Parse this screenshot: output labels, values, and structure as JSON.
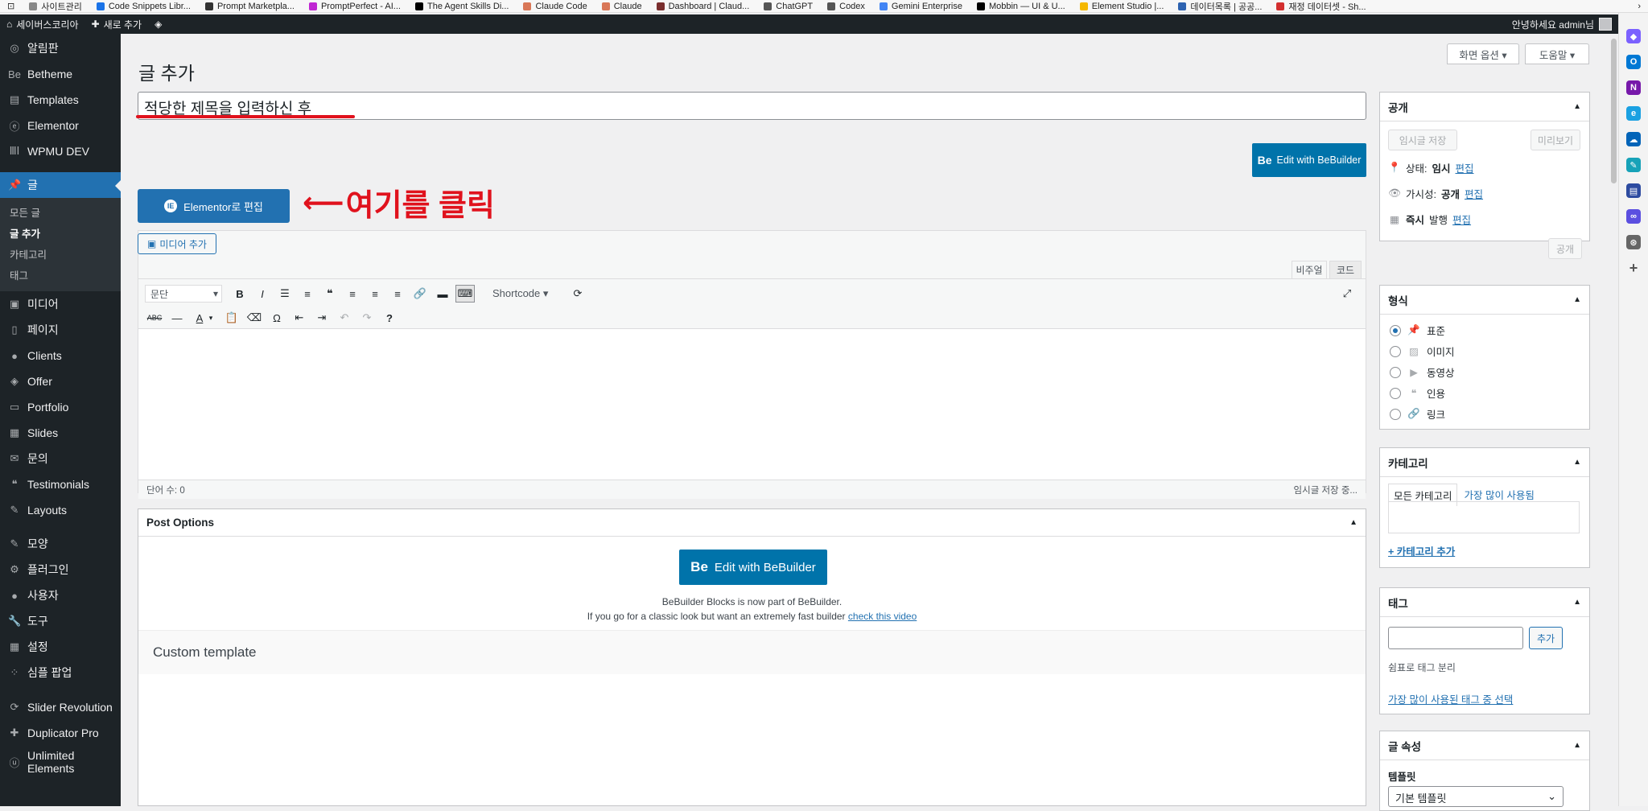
{
  "bookmarks": [
    {
      "label": "사이트관리",
      "color": "#888"
    },
    {
      "label": "Code Snippets Libr...",
      "color": "#1a73e8"
    },
    {
      "label": "Prompt Marketpla...",
      "color": "#333"
    },
    {
      "label": "PromptPerfect - AI...",
      "color": "#c026d3"
    },
    {
      "label": "The Agent Skills Di...",
      "color": "#000"
    },
    {
      "label": "Claude Code",
      "color": "#d97757"
    },
    {
      "label": "Claude",
      "color": "#d97757"
    },
    {
      "label": "Dashboard | Claud...",
      "color": "#7a2e2e"
    },
    {
      "label": "ChatGPT",
      "color": "#555"
    },
    {
      "label": "Codex",
      "color": "#555"
    },
    {
      "label": "Gemini Enterprise",
      "color": "#4285f4"
    },
    {
      "label": "Mobbin — UI & U...",
      "color": "#000"
    },
    {
      "label": "Element Studio |...",
      "color": "#f5b800"
    },
    {
      "label": "데이터목록 | 공공...",
      "color": "#2d62b0"
    },
    {
      "label": "재정 데이터셋 - Sh...",
      "color": "#d32f2f"
    }
  ],
  "adminbar": {
    "site": "세이버스코리아",
    "new": "새로 추가",
    "greeting": "안녕하세요 admin님"
  },
  "menu": {
    "items_top": [
      {
        "label": "알림판",
        "icon": "◎"
      },
      {
        "label": "Betheme",
        "icon": "Be"
      },
      {
        "label": "Templates",
        "icon": "▤"
      },
      {
        "label": "Elementor",
        "icon": "ⓔ"
      },
      {
        "label": "WPMU DEV",
        "icon": "ⅢⅠ"
      }
    ],
    "current": {
      "label": "글",
      "icon": "📌"
    },
    "sub": [
      "모든 글",
      "글 추가",
      "카테고리",
      "태그"
    ],
    "items_mid": [
      {
        "label": "미디어",
        "icon": "▣"
      },
      {
        "label": "페이지",
        "icon": "▯"
      },
      {
        "label": "Clients",
        "icon": "●"
      },
      {
        "label": "Offer",
        "icon": "◈"
      },
      {
        "label": "Portfolio",
        "icon": "▭"
      },
      {
        "label": "Slides",
        "icon": "▦"
      },
      {
        "label": "문의",
        "icon": "✉"
      },
      {
        "label": "Testimonials",
        "icon": "❝"
      },
      {
        "label": "Layouts",
        "icon": "✎"
      }
    ],
    "items_bottom": [
      {
        "label": "모양",
        "icon": "✎"
      },
      {
        "label": "플러그인",
        "icon": "⚙"
      },
      {
        "label": "사용자",
        "icon": "●"
      },
      {
        "label": "도구",
        "icon": "🔧"
      },
      {
        "label": "설정",
        "icon": "▦"
      },
      {
        "label": "심플 팝업",
        "icon": "⁘"
      }
    ],
    "items_plugins": [
      {
        "label": "Slider Revolution",
        "icon": "⟳"
      },
      {
        "label": "Duplicator Pro",
        "icon": "✚"
      },
      {
        "label": "Unlimited Elements",
        "icon": "ⓤ"
      }
    ]
  },
  "page": {
    "title": "글 추가",
    "screen_options": "화면 옵션 ▾",
    "help": "도움말 ▾",
    "post_title": "적당한 제목을 입력하신 후",
    "bebuilder_button": "Edit with BeBuilder",
    "elementor_button": "Elementor로 편집",
    "annotation": "여기를 클릭",
    "add_media": "미디어 추가",
    "tab_visual": "비주얼",
    "tab_code": "코드",
    "format": "문단",
    "shortcode": "Shortcode ▾",
    "word_count": "단어 수: 0",
    "draft_status": "임시글 저장 중..."
  },
  "post_options": {
    "title": "Post Options",
    "button": "Edit with BeBuilder",
    "note1": "BeBuilder Blocks is now part of BeBuilder.",
    "note2": "If you go for a classic look but want an extremely fast builder",
    "note_link": "check this video",
    "custom_template": "Custom template"
  },
  "publish": {
    "title": "공개",
    "save_draft": "임시글 저장",
    "preview": "미리보기",
    "status_label": "상태:",
    "status_value": "임시",
    "visibility_label": "가시성:",
    "visibility_value": "공개",
    "schedule_value": "즉시",
    "schedule_label": "발행",
    "edit": "편집",
    "publish_button": "공개"
  },
  "format_box": {
    "title": "형식",
    "options": [
      "표준",
      "이미지",
      "동영상",
      "인용",
      "링크"
    ],
    "selected": "표준"
  },
  "category_box": {
    "title": "카테고리",
    "tab_all": "모든 카테고리",
    "tab_popular": "가장 많이 사용됨",
    "add": "+ 카테고리 추가"
  },
  "tag_box": {
    "title": "태그",
    "add": "추가",
    "hint": "쉼표로 태그 분리",
    "popular": "가장 많이 사용된 태그 중 선택"
  },
  "attributes_box": {
    "title": "글 속성",
    "template_label": "템플릿",
    "template_value": "기본 템플릿"
  },
  "colors": {
    "wp_blue": "#2271b1",
    "be_blue": "#0073aa",
    "admin_dark": "#1d2327",
    "annotation_red": "#e0121d"
  }
}
